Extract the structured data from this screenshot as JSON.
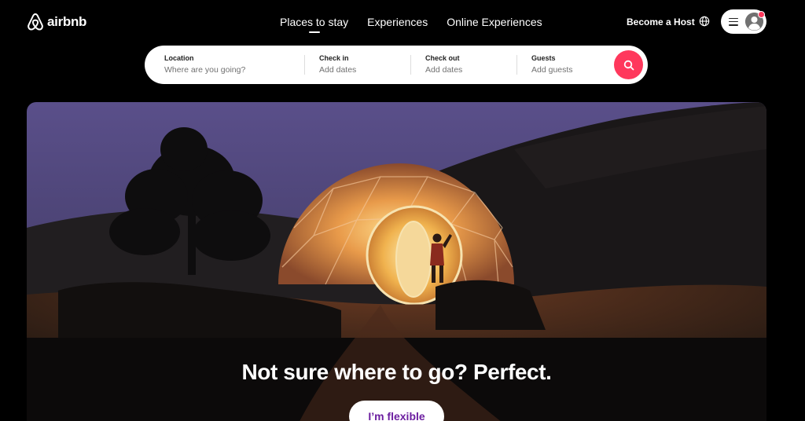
{
  "brand": {
    "name": "airbnb"
  },
  "nav": {
    "tabs": [
      {
        "label": "Places to stay",
        "active": true
      },
      {
        "label": "Experiences",
        "active": false
      },
      {
        "label": "Online Experiences",
        "active": false
      }
    ]
  },
  "header": {
    "host_link": "Become a Host",
    "globe_icon": "globe-icon",
    "menu_icon": "hamburger-icon",
    "avatar_icon": "user-avatar-icon"
  },
  "search": {
    "location": {
      "label": "Location",
      "placeholder": "Where are you going?"
    },
    "checkin": {
      "label": "Check in",
      "placeholder": "Add dates"
    },
    "checkout": {
      "label": "Check out",
      "placeholder": "Add dates"
    },
    "guests": {
      "label": "Guests",
      "placeholder": "Add guests"
    },
    "button_icon": "search-icon"
  },
  "hero": {
    "title": "Not sure where to go? Perfect.",
    "button_label": "I’m flexible"
  },
  "colors": {
    "brand_accent": "#ff385c",
    "flexible_text": "#6c1fa0",
    "background": "#000000"
  }
}
